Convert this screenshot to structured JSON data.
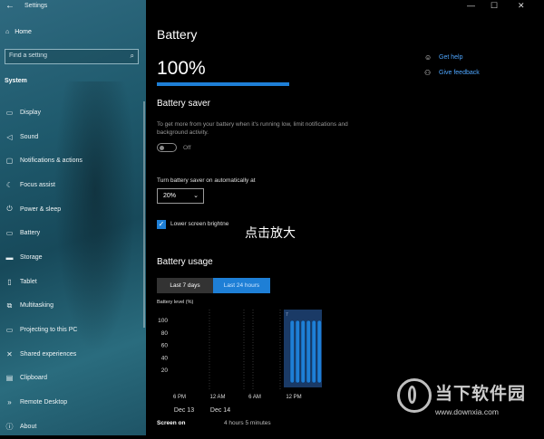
{
  "titlebar": {
    "back_icon": "back-arrow-icon",
    "title": "Settings"
  },
  "sidebar": {
    "home_label": "Home",
    "search_placeholder": "Find a setting",
    "section": "System",
    "items": [
      {
        "label": "Display",
        "icon": "display-icon"
      },
      {
        "label": "Sound",
        "icon": "sound-icon"
      },
      {
        "label": "Notifications & actions",
        "icon": "notifications-icon"
      },
      {
        "label": "Focus assist",
        "icon": "moon-icon"
      },
      {
        "label": "Power & sleep",
        "icon": "power-icon"
      },
      {
        "label": "Battery",
        "icon": "battery-icon"
      },
      {
        "label": "Storage",
        "icon": "storage-icon"
      },
      {
        "label": "Tablet",
        "icon": "tablet-icon"
      },
      {
        "label": "Multitasking",
        "icon": "multitasking-icon"
      },
      {
        "label": "Projecting to this PC",
        "icon": "projecting-icon"
      },
      {
        "label": "Shared experiences",
        "icon": "share-icon"
      },
      {
        "label": "Clipboard",
        "icon": "clipboard-icon"
      },
      {
        "label": "Remote Desktop",
        "icon": "remote-desktop-icon"
      },
      {
        "label": "About",
        "icon": "info-icon"
      }
    ]
  },
  "main": {
    "title": "Battery",
    "percent": "100%",
    "percent_value": 100,
    "help_links": [
      {
        "label": "Get help",
        "icon": "help-chat-icon"
      },
      {
        "label": "Give feedback",
        "icon": "feedback-icon"
      }
    ],
    "battery_saver": {
      "heading": "Battery saver",
      "description": "To get more from your battery when it's running low, limit notifications and background activity.",
      "toggle_label": "Off",
      "toggle_on": false,
      "auto_label": "Turn battery saver on automatically at",
      "auto_value": "20%",
      "brightness_label": "Lower screen brightne",
      "brightness_checked": true
    },
    "overlay_text": "点击放大",
    "usage": {
      "heading": "Battery usage",
      "tabs": [
        {
          "label": "Last 7 days",
          "active": false
        },
        {
          "label": "Last 24 hours",
          "active": true
        }
      ],
      "screen_on_label": "Screen on",
      "screen_on_value": "4 hours 5 minutes"
    }
  },
  "chart_data": {
    "type": "bar",
    "title": "Battery level (%)",
    "yticks": [
      20,
      40,
      60,
      80,
      100
    ],
    "ylim": [
      0,
      100
    ],
    "xticks": [
      "6 PM",
      "12 AM",
      "6 AM",
      "12 PM"
    ],
    "date_labels": [
      "Dec 13",
      "Dec 14"
    ],
    "series": [
      {
        "values": [
          100,
          100,
          100,
          100,
          100,
          100
        ]
      }
    ],
    "colors": {
      "bar": "#1e7fd6",
      "highlight": "#1a3a66"
    }
  },
  "watermark": {
    "text": "当下软件园",
    "url": "www.downxia.com"
  }
}
